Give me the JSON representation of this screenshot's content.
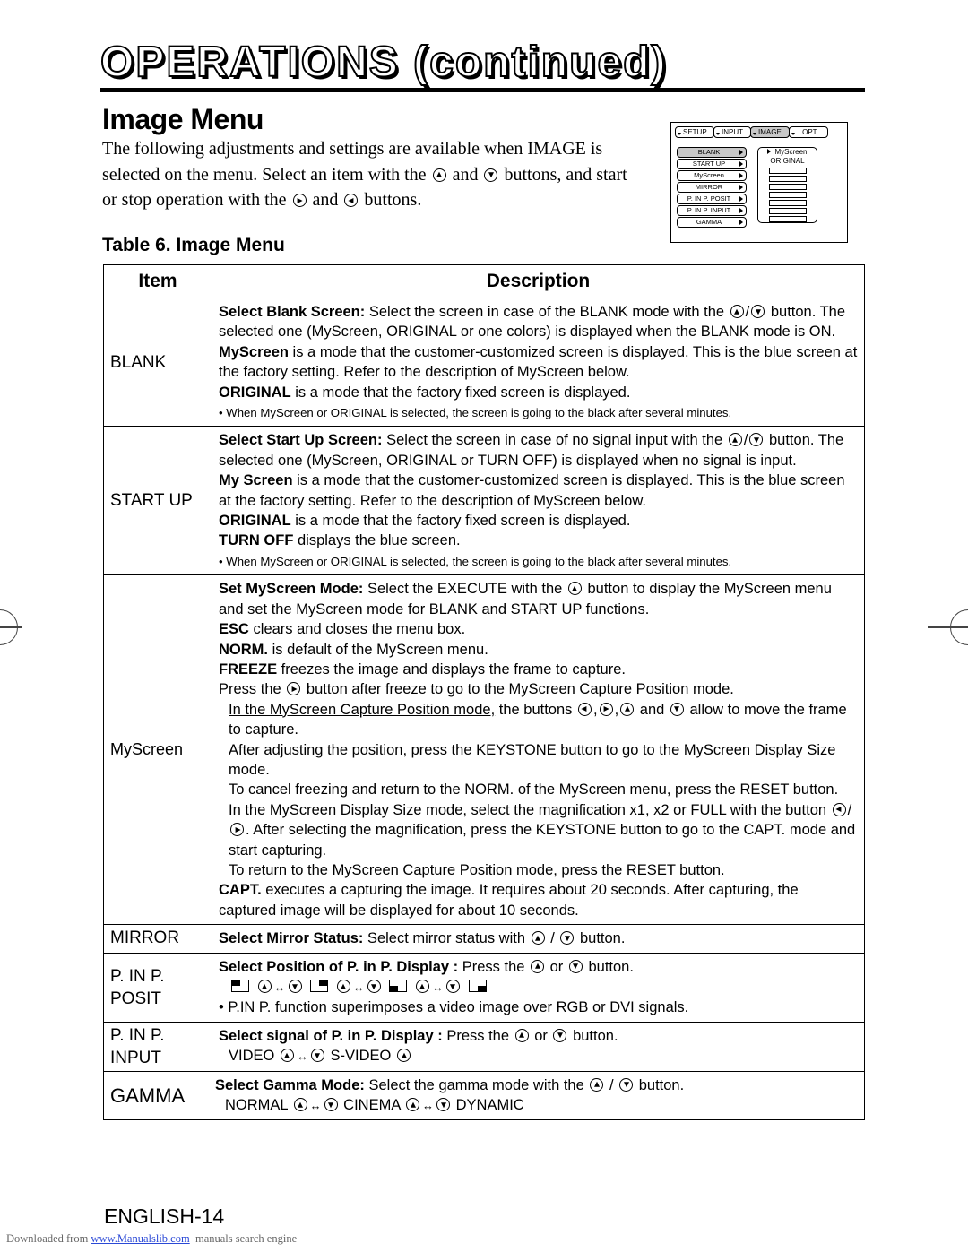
{
  "header": {
    "title": "OPERATIONS (continued)",
    "section_title": "Image Menu"
  },
  "intro": {
    "part1": "The following adjustments and settings are available when IMAGE is selected on the menu. Select an item with the",
    "and1": "and",
    "part2": "buttons, and start or stop operation with the",
    "and2": "and",
    "part3": "buttons."
  },
  "osd_menu": {
    "tabs": [
      "SETUP",
      "INPUT",
      "IMAGE",
      "OPT."
    ],
    "active_tab": "IMAGE",
    "items": [
      "BLANK",
      "START UP",
      "MyScreen",
      "MIRROR",
      "P. IN P. POSIT",
      "P. IN P. INPUT",
      "GAMMA"
    ],
    "active_item": "BLANK",
    "submenu_options": [
      "MyScreen",
      "ORIGINAL"
    ],
    "submenu_selected": "MyScreen"
  },
  "table": {
    "caption": "Table 6. Image Menu",
    "headers": {
      "item": "Item",
      "description": "Description"
    },
    "rows": {
      "blank": {
        "item": "BLANK",
        "lead_bold": "Select Blank Screen:",
        "lead_text": " Select the screen in case of the BLANK mode with the",
        "lead_tail": "button. The selected one (MyScreen, ORIGINAL or one colors) is displayed when the BLANK mode is ON.",
        "myscreen_bold": "MyScreen",
        "myscreen_text": " is a mode that the customer-customized screen is displayed. This is the blue screen at the factory setting. Refer to the description of MyScreen below.",
        "original_bold": "ORIGINAL",
        "original_text": " is a mode that the factory fixed screen is displayed.",
        "note": "• When MyScreen or ORIGINAL is selected, the screen is going to the black after several minutes."
      },
      "startup": {
        "item": "START UP",
        "lead_bold": "Select Start Up Screen:",
        "lead_text": " Select the screen in case of no signal input with the",
        "lead_tail": "button. The selected one (MyScreen, ORIGINAL or TURN OFF) is displayed when no signal is input.",
        "myscreen_bold": "My Screen",
        "myscreen_text": " is a mode that the customer-customized screen is displayed. This is the blue screen at the factory setting. Refer to the description of MyScreen below.",
        "original_bold": "ORIGINAL",
        "original_text": " is a mode that the factory fixed screen is displayed.",
        "turnoff_bold": "TURN OFF",
        "turnoff_text": " displays the blue screen.",
        "note": "• When MyScreen or ORIGINAL is selected, the screen is going to the black after several minutes."
      },
      "myscreen": {
        "item": "MyScreen",
        "lead_bold": "Set MyScreen Mode:",
        "lead_text": " Select the EXECUTE with the",
        "lead_tail": "button to display the MyScreen menu and set the MyScreen mode for BLANK and START UP functions.",
        "esc_bold": "ESC",
        "esc_text": " clears and closes the menu box.",
        "norm_bold": "NORM.",
        "norm_text": " is default of the MyScreen menu.",
        "freeze_bold": "FREEZE",
        "freeze_text": " freezes the image and displays the frame to capture.",
        "press_a": "Press the",
        "press_b": "button after freeze to go to the MyScreen Capture Position mode.",
        "cap_pos_u": "In the MyScreen Capture Position mode,",
        "cap_pos_a": " the buttons",
        "cap_pos_and": "and",
        "cap_pos_b": "allow to move the frame to capture.",
        "adjust": "After adjusting the position, press the KEYSTONE button to go to the MyScreen Display Size mode.",
        "cancel": "To cancel freezing and return to the NORM. of the MyScreen menu, press the RESET button.",
        "size_u": "In the MyScreen Display Size mode",
        "size_a": ", select the magnification x1, x2 or FULL with the button",
        "size_b": ". After selecting the magnification, press the KEYSTONE button to go to the CAPT. mode and start capturing.",
        "return": "To return to the MyScreen Capture Position mode, press the RESET button.",
        "capt_bold": "CAPT.",
        "capt_text": " executes a capturing the image. It requires about 20 seconds. After capturing, the captured image will be displayed for about 10 seconds."
      },
      "mirror": {
        "item": "MIRROR",
        "lead_bold": "Select Mirror Status:",
        "lead_text": " Select mirror status with",
        "slash": "/",
        "lead_tail": "button."
      },
      "pinp_posit": {
        "item_line1": "P. IN P.",
        "item_line2": "POSIT",
        "lead_bold": "Select Position of P. in P. Display :",
        "lead_text": " Press the",
        "or": "or",
        "lead_tail": "button.",
        "arrow": "↔",
        "note": "• P.IN P. function superimposes a video image over RGB or DVI signals."
      },
      "pinp_input": {
        "item_line1": "P. IN P.",
        "item_line2": "INPUT",
        "lead_bold": "Select signal of P. in P. Display :",
        "lead_text": " Press the",
        "or": "or",
        "lead_tail": "button.",
        "opt1": "VIDEO",
        "opt2": "S-VIDEO",
        "arrow": "↔"
      },
      "gamma": {
        "item": "GAMMA",
        "lead_bold": "Select Gamma Mode:",
        "lead_text": " Select the gamma mode with the",
        "slash": "/",
        "lead_tail": "button.",
        "opt1": "NORMAL",
        "opt2": "CINEMA",
        "opt3": "DYNAMIC",
        "arrow": "↔"
      }
    }
  },
  "page_number": "ENGLISH-14",
  "footer": {
    "prefix": "Downloaded from ",
    "link": "www.Manualslib.com",
    "suffix": "  manuals search engine"
  }
}
